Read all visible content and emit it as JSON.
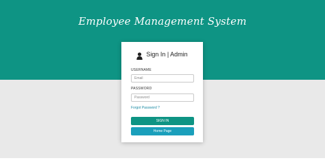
{
  "app": {
    "title": "Employee Management System"
  },
  "login_card": {
    "title": "Sign In | Admin",
    "username_label": "USERNAME",
    "username_placeholder": "Email",
    "password_label": "PASSWORD",
    "password_placeholder": "Password",
    "forgot_link": "Forgot Password ?",
    "signin_button": "SIGN IN",
    "home_button": "Home Page"
  },
  "colors": {
    "brand_teal": "#0e9484",
    "link_blue": "#1a8aa3",
    "home_button": "#1a9fbb",
    "background": "#e9e9e9"
  },
  "icons": {
    "header": "user-icon"
  }
}
